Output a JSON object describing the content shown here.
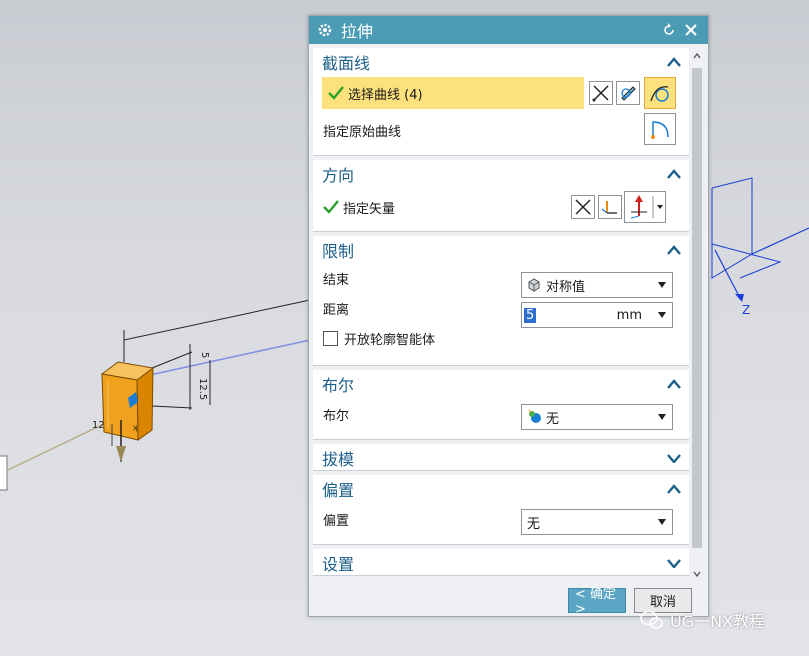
{
  "dialog": {
    "title": "拉伸",
    "sections": {
      "section_curve": {
        "header": "截面线",
        "select_curve_label": "选择曲线 (4)",
        "original_curve_label": "指定原始曲线"
      },
      "direction": {
        "header": "方向",
        "vector_label": "指定矢量"
      },
      "limits": {
        "header": "限制",
        "end_label": "结束",
        "end_value": "对称值",
        "distance_label": "距离",
        "distance_value": "5",
        "distance_unit": "mm",
        "open_profile_label": "开放轮廓智能体"
      },
      "boolean": {
        "header": "布尔",
        "label": "布尔",
        "value": "无"
      },
      "draft": {
        "header": "拔模"
      },
      "offset": {
        "header": "偏置",
        "label": "偏置",
        "value": "无"
      },
      "settings": {
        "header": "设置"
      }
    },
    "ok_button": "< 确定 >",
    "cancel_button": "取消"
  },
  "viewport": {
    "dim_labels": [
      "5",
      "12.5",
      "12"
    ],
    "axis_label_z": "Z"
  },
  "watermark": "UG一NX教程",
  "colors": {
    "title_bar": "#4a9bb3",
    "section_header": "#1c5f8a",
    "highlight": "#fde17c",
    "solid_body": "#f0a21e",
    "wcs_axis": "#1a3fd6"
  }
}
